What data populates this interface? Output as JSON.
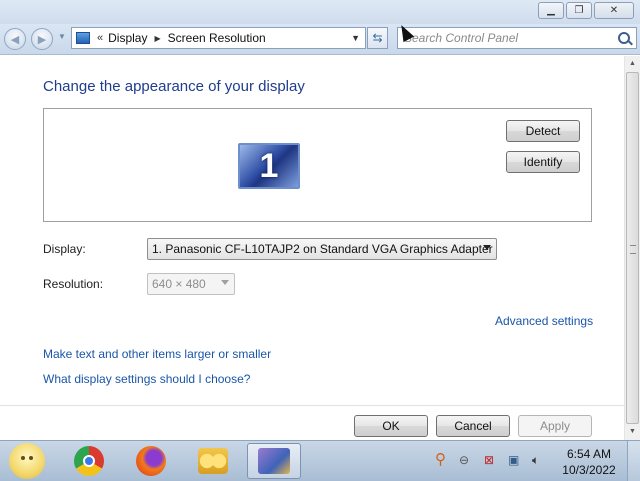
{
  "window": {
    "caption_buttons": [
      "minimize-icon",
      "restore-icon",
      "close-icon"
    ]
  },
  "navigation": {
    "back_icon": "back-arrow-icon",
    "forward_icon": "forward-arrow-icon",
    "breadcrumb_overflow": "«",
    "breadcrumb": [
      "Display",
      "Screen Resolution"
    ],
    "refresh_icon": "refresh-icon",
    "search_placeholder": "Search Control Panel"
  },
  "main": {
    "heading": "Change the appearance of your display",
    "monitor_label": "1",
    "detect_label": "Detect",
    "identify_label": "Identify",
    "display_label": "Display:",
    "display_value": "1. Panasonic CF-L10TAJP2 on Standard VGA Graphics Adapter",
    "resolution_label": "Resolution:",
    "resolution_value": "640 × 480",
    "advanced_link": "Advanced settings",
    "links": [
      "Make text and other items larger or smaller",
      "What display settings should I choose?"
    ]
  },
  "footer": {
    "ok_label": "OK",
    "cancel_label": "Cancel",
    "apply_label": "Apply"
  },
  "taskbar": {
    "apps": [
      "start-orb-icon",
      "chrome-icon",
      "firefox-icon",
      "folder-icon",
      "display-settings-icon"
    ],
    "tray_icons": [
      "search-tray-icon",
      "minus-circle-icon",
      "network-error-icon",
      "network-icon",
      "volume-icon"
    ],
    "time": "6:54 AM",
    "date": "10/3/2022"
  },
  "colors": {
    "heading": "#1e3d8f",
    "link": "#1a56a8",
    "taskbar": "#b8cadd"
  }
}
